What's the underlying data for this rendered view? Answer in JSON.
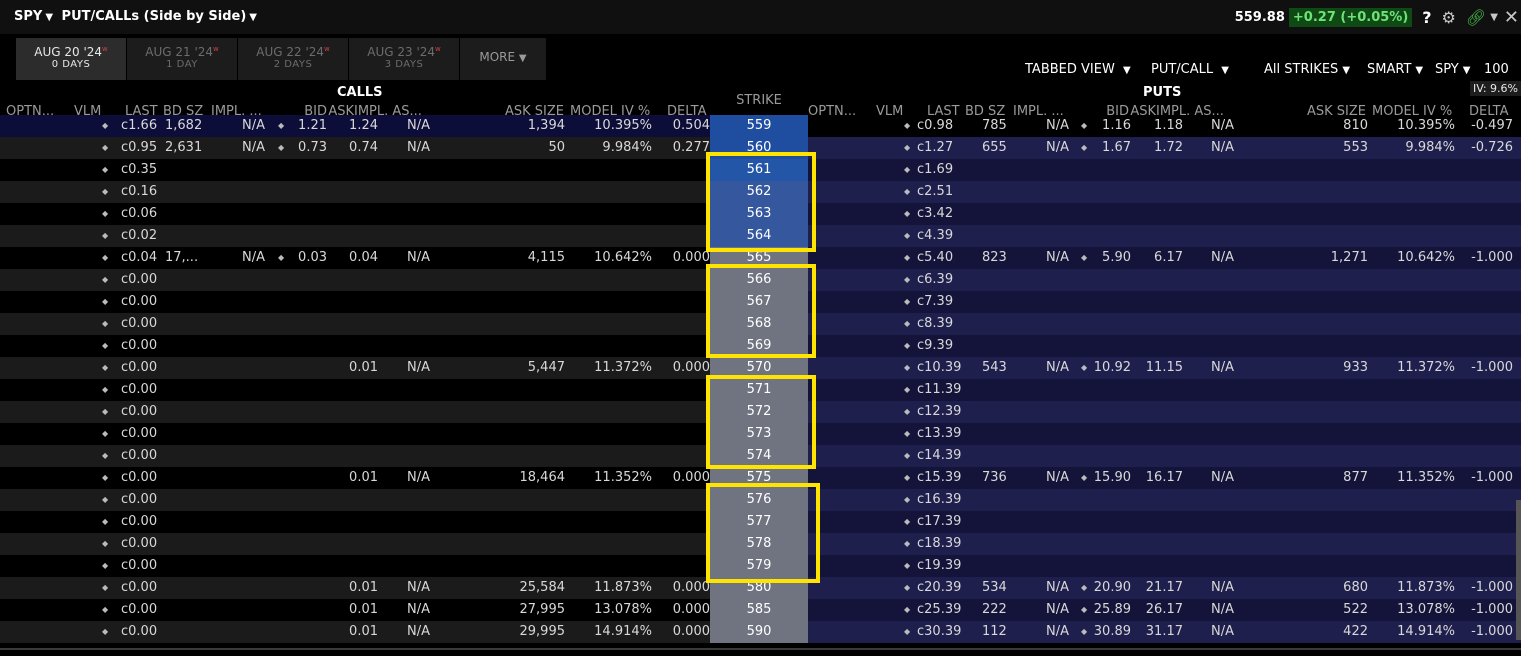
{
  "title": {
    "symbol": "SPY",
    "view": "PUT/CALLs (Side by Side)"
  },
  "quote": {
    "last": "559.88",
    "change": "+0.27 (+0.05%)"
  },
  "toolbar_icons": [
    "help-icon",
    "gear-icon",
    "link-icon",
    "chevron-down-icon",
    "close-icon"
  ],
  "tabs": [
    {
      "date": "AUG 20 '24",
      "sup": "w",
      "sub": "0 DAYS",
      "active": true
    },
    {
      "date": "AUG 21 '24",
      "sup": "w",
      "sub": "1 DAY",
      "active": false
    },
    {
      "date": "AUG 22 '24",
      "sup": "w",
      "sub": "2 DAYS",
      "active": false
    },
    {
      "date": "AUG 23 '24",
      "sup": "w",
      "sub": "3 DAYS",
      "active": false
    }
  ],
  "more_label": "MORE",
  "options": {
    "tabbed_view": "TABBED VIEW",
    "put_call": "PUT/CALL",
    "strikes": "All STRIKES",
    "exchange": "SMART",
    "underlying": "SPY",
    "multiplier": "100"
  },
  "iv_badge": "IV: 9.6%",
  "calls_label": "CALLS",
  "puts_label": "PUTS",
  "strike_label": "STRIKE",
  "columns": [
    "OPTN...",
    "VLM",
    "LAST",
    "BD SZ",
    "IMPL. ...",
    "BID",
    "ASK",
    "IMPL. AS...",
    "ASK SIZE",
    "MODEL IV %",
    "DELTA"
  ],
  "colors": {
    "accent_highlight": "#ffe400",
    "change_bg": "#0f4a14",
    "change_fg": "#6ee37a",
    "atm_strike": "#1f4ea0",
    "strike_bg": "#6f7480",
    "puts_bg": "#16163c"
  },
  "rows": [
    {
      "strike": "559",
      "call": {
        "last": "c1.66",
        "bdsz": "1,682",
        "impl": "N/A",
        "bid": "1.21",
        "ask": "1.24",
        "impla": "N/A",
        "asksize": "1,394",
        "iv": "10.395%",
        "delta": "0.504"
      },
      "put": {
        "last": "c0.98",
        "bdsz": "785",
        "impl": "N/A",
        "bid": "1.16",
        "ask": "1.18",
        "impla": "N/A",
        "asksize": "810",
        "iv": "10.395%",
        "delta": "-0.497"
      }
    },
    {
      "strike": "560",
      "call": {
        "last": "c0.95",
        "bdsz": "2,631",
        "impl": "N/A",
        "bid": "0.73",
        "ask": "0.74",
        "impla": "N/A",
        "asksize": "50",
        "iv": "9.984%",
        "delta": "0.277"
      },
      "put": {
        "last": "c1.27",
        "bdsz": "655",
        "impl": "N/A",
        "bid": "1.67",
        "ask": "1.72",
        "impla": "N/A",
        "asksize": "553",
        "iv": "9.984%",
        "delta": "-0.726"
      }
    },
    {
      "strike": "561",
      "call": {
        "last": "c0.35"
      },
      "put": {
        "last": "c1.69"
      }
    },
    {
      "strike": "562",
      "call": {
        "last": "c0.16"
      },
      "put": {
        "last": "c2.51"
      }
    },
    {
      "strike": "563",
      "call": {
        "last": "c0.06"
      },
      "put": {
        "last": "c3.42"
      }
    },
    {
      "strike": "564",
      "call": {
        "last": "c0.02"
      },
      "put": {
        "last": "c4.39"
      }
    },
    {
      "strike": "565",
      "call": {
        "last": "c0.04",
        "bdsz": "17,...",
        "impl": "N/A",
        "bid": "0.03",
        "ask": "0.04",
        "impla": "N/A",
        "asksize": "4,115",
        "iv": "10.642%",
        "delta": "0.000"
      },
      "put": {
        "last": "c5.40",
        "bdsz": "823",
        "impl": "N/A",
        "bid": "5.90",
        "ask": "6.17",
        "impla": "N/A",
        "asksize": "1,271",
        "iv": "10.642%",
        "delta": "-1.000"
      }
    },
    {
      "strike": "566",
      "call": {
        "last": "c0.00"
      },
      "put": {
        "last": "c6.39"
      }
    },
    {
      "strike": "567",
      "call": {
        "last": "c0.00"
      },
      "put": {
        "last": "c7.39"
      }
    },
    {
      "strike": "568",
      "call": {
        "last": "c0.00"
      },
      "put": {
        "last": "c8.39"
      }
    },
    {
      "strike": "569",
      "call": {
        "last": "c0.00"
      },
      "put": {
        "last": "c9.39"
      }
    },
    {
      "strike": "570",
      "call": {
        "last": "c0.00",
        "ask": "0.01",
        "impla": "N/A",
        "asksize": "5,447",
        "iv": "11.372%",
        "delta": "0.000"
      },
      "put": {
        "last": "c10.39",
        "bdsz": "543",
        "impl": "N/A",
        "bid": "10.92",
        "ask": "11.15",
        "impla": "N/A",
        "asksize": "933",
        "iv": "11.372%",
        "delta": "-1.000"
      }
    },
    {
      "strike": "571",
      "call": {
        "last": "c0.00"
      },
      "put": {
        "last": "c11.39"
      }
    },
    {
      "strike": "572",
      "call": {
        "last": "c0.00"
      },
      "put": {
        "last": "c12.39"
      }
    },
    {
      "strike": "573",
      "call": {
        "last": "c0.00"
      },
      "put": {
        "last": "c13.39"
      }
    },
    {
      "strike": "574",
      "call": {
        "last": "c0.00"
      },
      "put": {
        "last": "c14.39"
      }
    },
    {
      "strike": "575",
      "call": {
        "last": "c0.00",
        "ask": "0.01",
        "impla": "N/A",
        "asksize": "18,464",
        "iv": "11.352%",
        "delta": "0.000"
      },
      "put": {
        "last": "c15.39",
        "bdsz": "736",
        "impl": "N/A",
        "bid": "15.90",
        "ask": "16.17",
        "impla": "N/A",
        "asksize": "877",
        "iv": "11.352%",
        "delta": "-1.000"
      }
    },
    {
      "strike": "576",
      "call": {
        "last": "c0.00"
      },
      "put": {
        "last": "c16.39"
      }
    },
    {
      "strike": "577",
      "call": {
        "last": "c0.00"
      },
      "put": {
        "last": "c17.39"
      }
    },
    {
      "strike": "578",
      "call": {
        "last": "c0.00"
      },
      "put": {
        "last": "c18.39"
      }
    },
    {
      "strike": "579",
      "call": {
        "last": "c0.00"
      },
      "put": {
        "last": "c19.39"
      }
    },
    {
      "strike": "580",
      "call": {
        "last": "c0.00",
        "ask": "0.01",
        "impla": "N/A",
        "asksize": "25,584",
        "iv": "11.873%",
        "delta": "0.000"
      },
      "put": {
        "last": "c20.39",
        "bdsz": "534",
        "impl": "N/A",
        "bid": "20.90",
        "ask": "21.17",
        "impla": "N/A",
        "asksize": "680",
        "iv": "11.873%",
        "delta": "-1.000"
      }
    },
    {
      "strike": "585",
      "call": {
        "last": "c0.00",
        "ask": "0.01",
        "impla": "N/A",
        "asksize": "27,995",
        "iv": "13.078%",
        "delta": "0.000"
      },
      "put": {
        "last": "c25.39",
        "bdsz": "222",
        "impl": "N/A",
        "bid": "25.89",
        "ask": "26.17",
        "impla": "N/A",
        "asksize": "522",
        "iv": "13.078%",
        "delta": "-1.000"
      }
    },
    {
      "strike": "590",
      "call": {
        "last": "c0.00",
        "ask": "0.01",
        "impla": "N/A",
        "asksize": "29,995",
        "iv": "14.914%",
        "delta": "0.000"
      },
      "put": {
        "last": "c30.39",
        "bdsz": "112",
        "impl": "N/A",
        "bid": "30.89",
        "ask": "31.17",
        "impla": "N/A",
        "asksize": "422",
        "iv": "14.914%",
        "delta": "-1.000"
      }
    }
  ]
}
